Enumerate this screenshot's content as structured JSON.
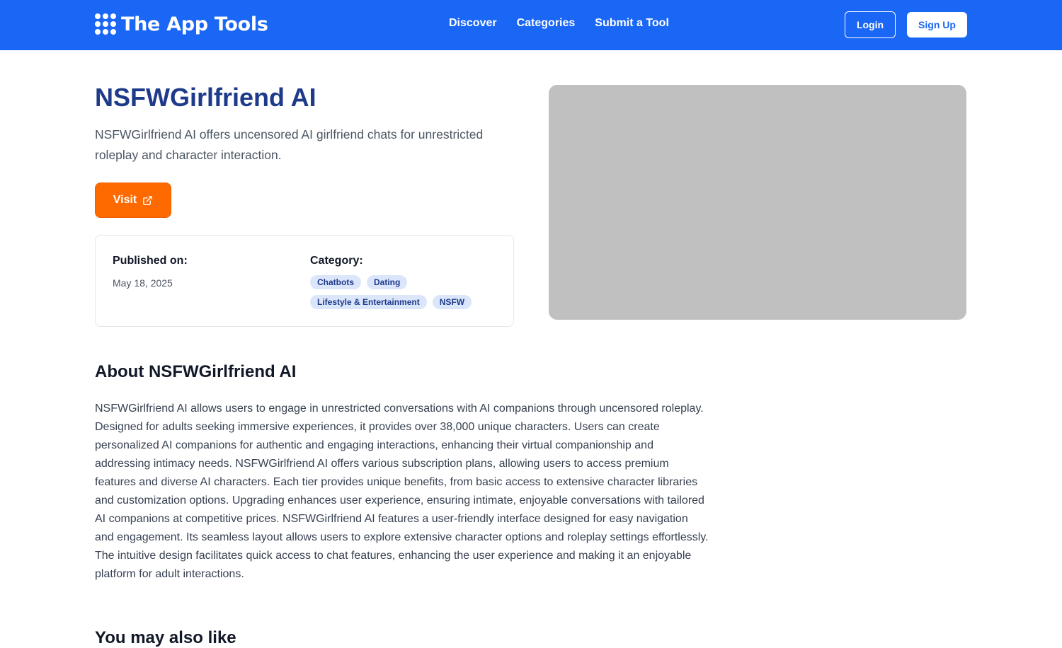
{
  "header": {
    "brand": "The App Tools",
    "nav": [
      "Discover",
      "Categories",
      "Submit a Tool"
    ],
    "login_label": "Login",
    "signup_label": "Sign Up",
    "brand_color": "#1a66f5"
  },
  "tool": {
    "name": "NSFWGirlfriend AI",
    "tagline": "NSFWGirlfriend AI offers uncensored AI girlfriend chats for unrestricted roleplay and character interaction.",
    "visit_label": "Visit",
    "visit_icon": "external-link-icon",
    "accent_color": "#ff6a00",
    "published_label": "Published on:",
    "published_date": "May 18, 2025",
    "category_label": "Category:",
    "categories": [
      "Chatbots",
      "Dating",
      "Lifestyle & Entertainment",
      "NSFW"
    ]
  },
  "about": {
    "heading": "About NSFWGirlfriend AI",
    "body": "NSFWGirlfriend AI allows users to engage in unrestricted conversations with AI companions through uncensored roleplay. Designed for adults seeking immersive experiences, it provides over 38,000 unique characters. Users can create personalized AI companions for authentic and engaging interactions, enhancing their virtual companionship and addressing intimacy needs. NSFWGirlfriend AI offers various subscription plans, allowing users to access premium features and diverse AI characters. Each tier provides unique benefits, from basic access to extensive character libraries and customization options. Upgrading enhances user experience, ensuring intimate, enjoyable conversations with tailored AI companions at competitive prices. NSFWGirlfriend AI features a user-friendly interface designed for easy navigation and engagement. Its seamless layout allows users to explore extensive character options and roleplay settings effortlessly. The intuitive design facilitates quick access to chat features, enhancing the user experience and making it an enjoyable platform for adult interactions."
  },
  "next_section": {
    "heading": "You may also like"
  }
}
